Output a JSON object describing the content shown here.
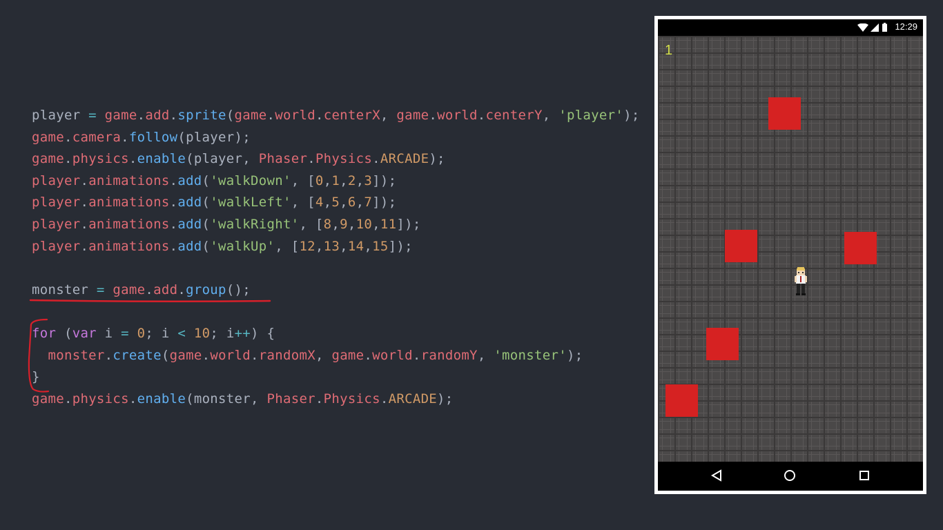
{
  "code": {
    "lines": [
      [
        {
          "t": "player",
          "c": "plain"
        },
        {
          "t": " = ",
          "c": "op"
        },
        {
          "t": "game",
          "c": "var"
        },
        {
          "t": ".",
          "c": "plain"
        },
        {
          "t": "add",
          "c": "var"
        },
        {
          "t": ".",
          "c": "plain"
        },
        {
          "t": "sprite",
          "c": "fn"
        },
        {
          "t": "(",
          "c": "plain"
        },
        {
          "t": "game",
          "c": "var"
        },
        {
          "t": ".",
          "c": "plain"
        },
        {
          "t": "world",
          "c": "var"
        },
        {
          "t": ".",
          "c": "plain"
        },
        {
          "t": "centerX",
          "c": "var"
        },
        {
          "t": ", ",
          "c": "plain"
        },
        {
          "t": "game",
          "c": "var"
        },
        {
          "t": ".",
          "c": "plain"
        },
        {
          "t": "world",
          "c": "var"
        },
        {
          "t": ".",
          "c": "plain"
        },
        {
          "t": "centerY",
          "c": "var"
        },
        {
          "t": ", ",
          "c": "plain"
        },
        {
          "t": "'player'",
          "c": "str"
        },
        {
          "t": ");",
          "c": "plain"
        }
      ],
      [
        {
          "t": "game",
          "c": "var"
        },
        {
          "t": ".",
          "c": "plain"
        },
        {
          "t": "camera",
          "c": "var"
        },
        {
          "t": ".",
          "c": "plain"
        },
        {
          "t": "follow",
          "c": "fn"
        },
        {
          "t": "(player);",
          "c": "plain"
        }
      ],
      [
        {
          "t": "game",
          "c": "var"
        },
        {
          "t": ".",
          "c": "plain"
        },
        {
          "t": "physics",
          "c": "var"
        },
        {
          "t": ".",
          "c": "plain"
        },
        {
          "t": "enable",
          "c": "fn"
        },
        {
          "t": "(player, ",
          "c": "plain"
        },
        {
          "t": "Phaser",
          "c": "var"
        },
        {
          "t": ".",
          "c": "plain"
        },
        {
          "t": "Physics",
          "c": "var"
        },
        {
          "t": ".",
          "c": "plain"
        },
        {
          "t": "ARCADE",
          "c": "const"
        },
        {
          "t": ");",
          "c": "plain"
        }
      ],
      [
        {
          "t": "player",
          "c": "var"
        },
        {
          "t": ".",
          "c": "plain"
        },
        {
          "t": "animations",
          "c": "var"
        },
        {
          "t": ".",
          "c": "plain"
        },
        {
          "t": "add",
          "c": "fn"
        },
        {
          "t": "(",
          "c": "plain"
        },
        {
          "t": "'walkDown'",
          "c": "str"
        },
        {
          "t": ", [",
          "c": "plain"
        },
        {
          "t": "0",
          "c": "num"
        },
        {
          "t": ",",
          "c": "plain"
        },
        {
          "t": "1",
          "c": "num"
        },
        {
          "t": ",",
          "c": "plain"
        },
        {
          "t": "2",
          "c": "num"
        },
        {
          "t": ",",
          "c": "plain"
        },
        {
          "t": "3",
          "c": "num"
        },
        {
          "t": "]);",
          "c": "plain"
        }
      ],
      [
        {
          "t": "player",
          "c": "var"
        },
        {
          "t": ".",
          "c": "plain"
        },
        {
          "t": "animations",
          "c": "var"
        },
        {
          "t": ".",
          "c": "plain"
        },
        {
          "t": "add",
          "c": "fn"
        },
        {
          "t": "(",
          "c": "plain"
        },
        {
          "t": "'walkLeft'",
          "c": "str"
        },
        {
          "t": ", [",
          "c": "plain"
        },
        {
          "t": "4",
          "c": "num"
        },
        {
          "t": ",",
          "c": "plain"
        },
        {
          "t": "5",
          "c": "num"
        },
        {
          "t": ",",
          "c": "plain"
        },
        {
          "t": "6",
          "c": "num"
        },
        {
          "t": ",",
          "c": "plain"
        },
        {
          "t": "7",
          "c": "num"
        },
        {
          "t": "]);",
          "c": "plain"
        }
      ],
      [
        {
          "t": "player",
          "c": "var"
        },
        {
          "t": ".",
          "c": "plain"
        },
        {
          "t": "animations",
          "c": "var"
        },
        {
          "t": ".",
          "c": "plain"
        },
        {
          "t": "add",
          "c": "fn"
        },
        {
          "t": "(",
          "c": "plain"
        },
        {
          "t": "'walkRight'",
          "c": "str"
        },
        {
          "t": ", [",
          "c": "plain"
        },
        {
          "t": "8",
          "c": "num"
        },
        {
          "t": ",",
          "c": "plain"
        },
        {
          "t": "9",
          "c": "num"
        },
        {
          "t": ",",
          "c": "plain"
        },
        {
          "t": "10",
          "c": "num"
        },
        {
          "t": ",",
          "c": "plain"
        },
        {
          "t": "11",
          "c": "num"
        },
        {
          "t": "]);",
          "c": "plain"
        }
      ],
      [
        {
          "t": "player",
          "c": "var"
        },
        {
          "t": ".",
          "c": "plain"
        },
        {
          "t": "animations",
          "c": "var"
        },
        {
          "t": ".",
          "c": "plain"
        },
        {
          "t": "add",
          "c": "fn"
        },
        {
          "t": "(",
          "c": "plain"
        },
        {
          "t": "'walkUp'",
          "c": "str"
        },
        {
          "t": ", [",
          "c": "plain"
        },
        {
          "t": "12",
          "c": "num"
        },
        {
          "t": ",",
          "c": "plain"
        },
        {
          "t": "13",
          "c": "num"
        },
        {
          "t": ",",
          "c": "plain"
        },
        {
          "t": "14",
          "c": "num"
        },
        {
          "t": ",",
          "c": "plain"
        },
        {
          "t": "15",
          "c": "num"
        },
        {
          "t": "]);",
          "c": "plain"
        }
      ],
      [],
      [
        {
          "t": "monster",
          "c": "plain"
        },
        {
          "t": " = ",
          "c": "op"
        },
        {
          "t": "game",
          "c": "var"
        },
        {
          "t": ".",
          "c": "plain"
        },
        {
          "t": "add",
          "c": "var"
        },
        {
          "t": ".",
          "c": "plain"
        },
        {
          "t": "group",
          "c": "fn"
        },
        {
          "t": "();",
          "c": "plain"
        }
      ],
      [],
      [
        {
          "t": "for",
          "c": "kw"
        },
        {
          "t": " (",
          "c": "plain"
        },
        {
          "t": "var",
          "c": "kw"
        },
        {
          "t": " i ",
          "c": "plain"
        },
        {
          "t": "=",
          "c": "op"
        },
        {
          "t": " ",
          "c": "plain"
        },
        {
          "t": "0",
          "c": "num"
        },
        {
          "t": "; i ",
          "c": "plain"
        },
        {
          "t": "<",
          "c": "op"
        },
        {
          "t": " ",
          "c": "plain"
        },
        {
          "t": "10",
          "c": "num"
        },
        {
          "t": "; i",
          "c": "plain"
        },
        {
          "t": "++",
          "c": "op"
        },
        {
          "t": ") {",
          "c": "plain"
        }
      ],
      [
        {
          "t": "  ",
          "c": "plain"
        },
        {
          "t": "monster",
          "c": "var"
        },
        {
          "t": ".",
          "c": "plain"
        },
        {
          "t": "create",
          "c": "fn"
        },
        {
          "t": "(",
          "c": "plain"
        },
        {
          "t": "game",
          "c": "var"
        },
        {
          "t": ".",
          "c": "plain"
        },
        {
          "t": "world",
          "c": "var"
        },
        {
          "t": ".",
          "c": "plain"
        },
        {
          "t": "randomX",
          "c": "var"
        },
        {
          "t": ", ",
          "c": "plain"
        },
        {
          "t": "game",
          "c": "var"
        },
        {
          "t": ".",
          "c": "plain"
        },
        {
          "t": "world",
          "c": "var"
        },
        {
          "t": ".",
          "c": "plain"
        },
        {
          "t": "randomY",
          "c": "var"
        },
        {
          "t": ", ",
          "c": "plain"
        },
        {
          "t": "'monster'",
          "c": "str"
        },
        {
          "t": ");",
          "c": "plain"
        }
      ],
      [
        {
          "t": "}",
          "c": "plain"
        }
      ],
      [
        {
          "t": "game",
          "c": "var"
        },
        {
          "t": ".",
          "c": "plain"
        },
        {
          "t": "physics",
          "c": "var"
        },
        {
          "t": ".",
          "c": "plain"
        },
        {
          "t": "enable",
          "c": "fn"
        },
        {
          "t": "(monster, ",
          "c": "plain"
        },
        {
          "t": "Phaser",
          "c": "var"
        },
        {
          "t": ".",
          "c": "plain"
        },
        {
          "t": "Physics",
          "c": "var"
        },
        {
          "t": ".",
          "c": "plain"
        },
        {
          "t": "ARCADE",
          "c": "const"
        },
        {
          "t": ");",
          "c": "plain"
        }
      ]
    ]
  },
  "colors": {
    "background": "#282c34",
    "annotation_red": "#d8202a",
    "monster_red": "#d62222",
    "score_color": "#d4e04a"
  },
  "annotations": {
    "underline_target": "monster = game.add.group();",
    "bracket_target": "for loop"
  },
  "phone": {
    "status_bar": {
      "time": "12:29",
      "icons": [
        "wifi-icon",
        "signal-icon",
        "battery-icon"
      ]
    },
    "game": {
      "score": "1",
      "monster_count": 5,
      "player": "player-sprite"
    },
    "nav_bar": {
      "buttons": [
        "back-icon",
        "home-icon",
        "recents-icon"
      ]
    }
  }
}
